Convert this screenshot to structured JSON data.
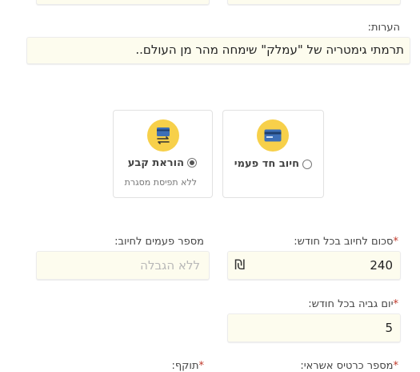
{
  "notes": {
    "label": "הערות:",
    "value": "תרמתי גימטריה של \"עמלק\" שימחה מהר מן העולם.."
  },
  "payment_options": [
    {
      "title": "חיוב חד פעמי",
      "subtitle": "",
      "selected": false,
      "icon": "credit-card-icon"
    },
    {
      "title": "הוראת קבע",
      "subtitle": "ללא תפיסת מסגרת",
      "selected": true,
      "icon": "recurring-card-icon"
    }
  ],
  "monthly_amount": {
    "required_mark": "*",
    "label": "סכום לחיוב בכל חודש:",
    "value": "240",
    "currency": "₪"
  },
  "charge_count": {
    "label": "מספר פעמים לחיוב:",
    "placeholder": "ללא הגבלה"
  },
  "collection_day": {
    "required_mark": "*",
    "label": "יום גביה בכל חודש:",
    "value": "5"
  },
  "card_number": {
    "required_mark": "*",
    "label": "מספר כרטיס אשראי:"
  },
  "expiry": {
    "required_mark": "*",
    "label": "תוקף:"
  },
  "colors": {
    "accent_yellow": "#f7d04a",
    "field_bg": "#fdfcee",
    "required_red": "#c0392b"
  }
}
